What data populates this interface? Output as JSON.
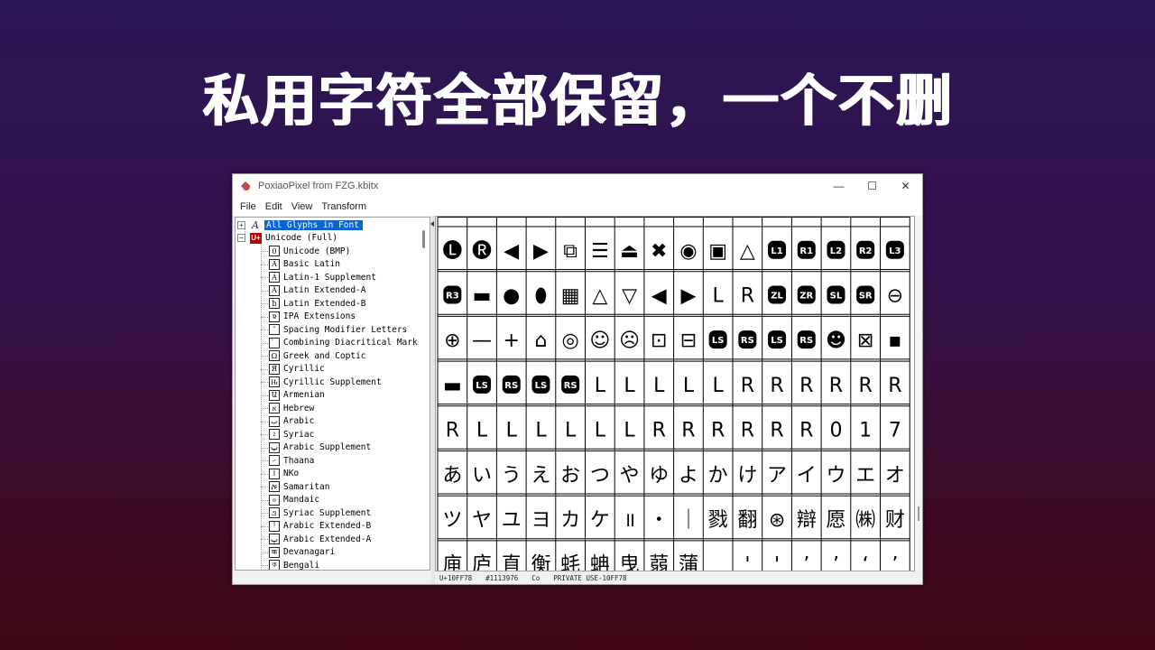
{
  "slide": {
    "title": "私用字符全部保留，一个不删"
  },
  "window": {
    "title": "PoxiaoPixel from FZG.kbitx",
    "controls": {
      "minimize": "—",
      "maximize": "☐",
      "close": "✕"
    },
    "menu": [
      "File",
      "Edit",
      "View",
      "Transform"
    ]
  },
  "tree": {
    "root_items": [
      {
        "label": "All Glyphs in Font",
        "icon": "a-italic-icon",
        "expander": "+",
        "selected": true
      },
      {
        "label": "Unicode (Full)",
        "icon": "unicode-icon",
        "icon_text": "U+",
        "expander": "−"
      }
    ],
    "blocks": [
      {
        "label": "Unicode (BMP)",
        "icon_text": "0"
      },
      {
        "label": "Basic Latin",
        "icon_text": "A"
      },
      {
        "label": "Latin-1 Supplement",
        "icon_text": "Á"
      },
      {
        "label": "Latin Extended-A",
        "icon_text": "Ā"
      },
      {
        "label": "Latin Extended-B",
        "icon_text": "ƀ"
      },
      {
        "label": "IPA Extensions",
        "icon_text": "ɐ"
      },
      {
        "label": "Spacing Modifier Letters",
        "icon_text": "ˆ"
      },
      {
        "label": "Combining Diacritical Marks",
        "icon_text": "̀"
      },
      {
        "label": "Greek and Coptic",
        "icon_text": "Ω"
      },
      {
        "label": "Cyrillic",
        "icon_text": "Я"
      },
      {
        "label": "Cyrillic Supplement",
        "icon_text": "Ԋ"
      },
      {
        "label": "Armenian",
        "icon_text": "Ա"
      },
      {
        "label": "Hebrew",
        "icon_text": "א"
      },
      {
        "label": "Arabic",
        "icon_text": "ب"
      },
      {
        "label": "Syriac",
        "icon_text": "ܐ"
      },
      {
        "label": "Arabic Supplement",
        "icon_text": "ݐ"
      },
      {
        "label": "Thaana",
        "icon_text": "ހ"
      },
      {
        "label": "NKo",
        "icon_text": "ߊ"
      },
      {
        "label": "Samaritan",
        "icon_text": "ࠀ"
      },
      {
        "label": "Mandaic",
        "icon_text": "ࡀ"
      },
      {
        "label": "Syriac Supplement",
        "icon_text": "ࡠ"
      },
      {
        "label": "Arabic Extended-B",
        "icon_text": "ࡰ"
      },
      {
        "label": "Arabic Extended-A",
        "icon_text": "ࢠ"
      },
      {
        "label": "Devanagari",
        "icon_text": "क"
      },
      {
        "label": "Bengali",
        "icon_text": "ক"
      }
    ]
  },
  "glyph_grid": {
    "rows": [
      [
        "🅛",
        "🅡",
        "◀",
        "▶",
        "⧉",
        "☰",
        "⏏",
        "✖",
        "◉",
        "▣",
        "△",
        "L1",
        "R1",
        "L2",
        "R2",
        "L3"
      ],
      [
        "R3",
        "▬",
        "●",
        "⬮",
        "▦",
        "△",
        "▽",
        "◀",
        "▶",
        "L",
        "R",
        "ZL",
        "ZR",
        "SL",
        "SR",
        "⊖"
      ],
      [
        "⊕",
        "—",
        "+",
        "⌂",
        "◎",
        "☺",
        "☹",
        "⊡",
        "⊟",
        "LS",
        "RS",
        "LS",
        "RS",
        "☻",
        "⊠",
        "▪"
      ],
      [
        "▬",
        "LS",
        "RS",
        "LS",
        "RS",
        "L",
        "L",
        "L",
        "L",
        "L",
        "R",
        "R",
        "R",
        "R",
        "R",
        "R"
      ],
      [
        "R",
        "L",
        "L",
        "L",
        "L",
        "L",
        "L",
        "R",
        "R",
        "R",
        "R",
        "R",
        "R",
        "0",
        "1",
        "7"
      ],
      [
        "あ",
        "い",
        "う",
        "え",
        "お",
        "つ",
        "や",
        "ゆ",
        "よ",
        "か",
        "け",
        "ア",
        "イ",
        "ウ",
        "エ",
        "オ"
      ],
      [
        "ツ",
        "ヤ",
        "ユ",
        "ヨ",
        "カ",
        "ケ",
        "॥",
        "・",
        "｜",
        "戮",
        "翻",
        "⊛",
        "辯",
        "愿",
        "㈱",
        "财"
      ],
      [
        "庘",
        "庐",
        "直",
        "衡",
        "蚝",
        "蚺",
        "曳",
        "蒻",
        "蒲",
        "",
        "'",
        "'",
        "’",
        "’",
        "‘",
        "’"
      ]
    ]
  },
  "status": {
    "codepoint": "U+10FF78",
    "decimal": "#1113976",
    "category": "Co",
    "name": "PRIVATE USE-10FF78"
  }
}
